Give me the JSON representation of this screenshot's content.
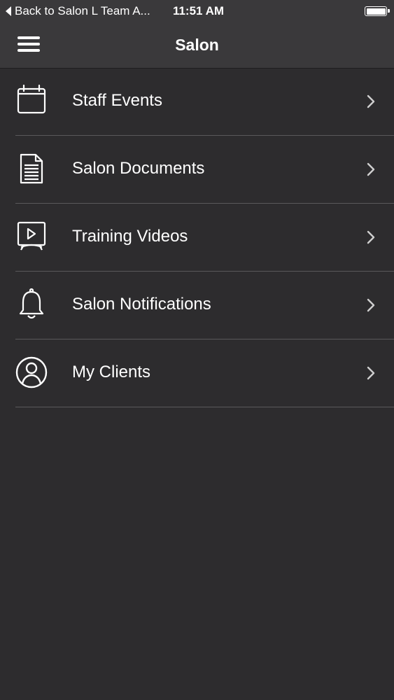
{
  "status_bar": {
    "back_label": "Back to Salon L Team A...",
    "time": "11:51 AM"
  },
  "nav": {
    "title": "Salon",
    "menu_icon": "hamburger-icon"
  },
  "menu": {
    "items": [
      {
        "label": "Staff Events",
        "icon": "calendar-icon"
      },
      {
        "label": "Salon Documents",
        "icon": "document-icon"
      },
      {
        "label": "Training Videos",
        "icon": "video-screen-icon"
      },
      {
        "label": "Salon Notifications",
        "icon": "bell-icon"
      },
      {
        "label": "My Clients",
        "icon": "user-icon"
      }
    ]
  },
  "colors": {
    "background": "#2d2c2e",
    "bar": "#3a393b",
    "divider": "#5a595b",
    "text": "#ffffff"
  }
}
